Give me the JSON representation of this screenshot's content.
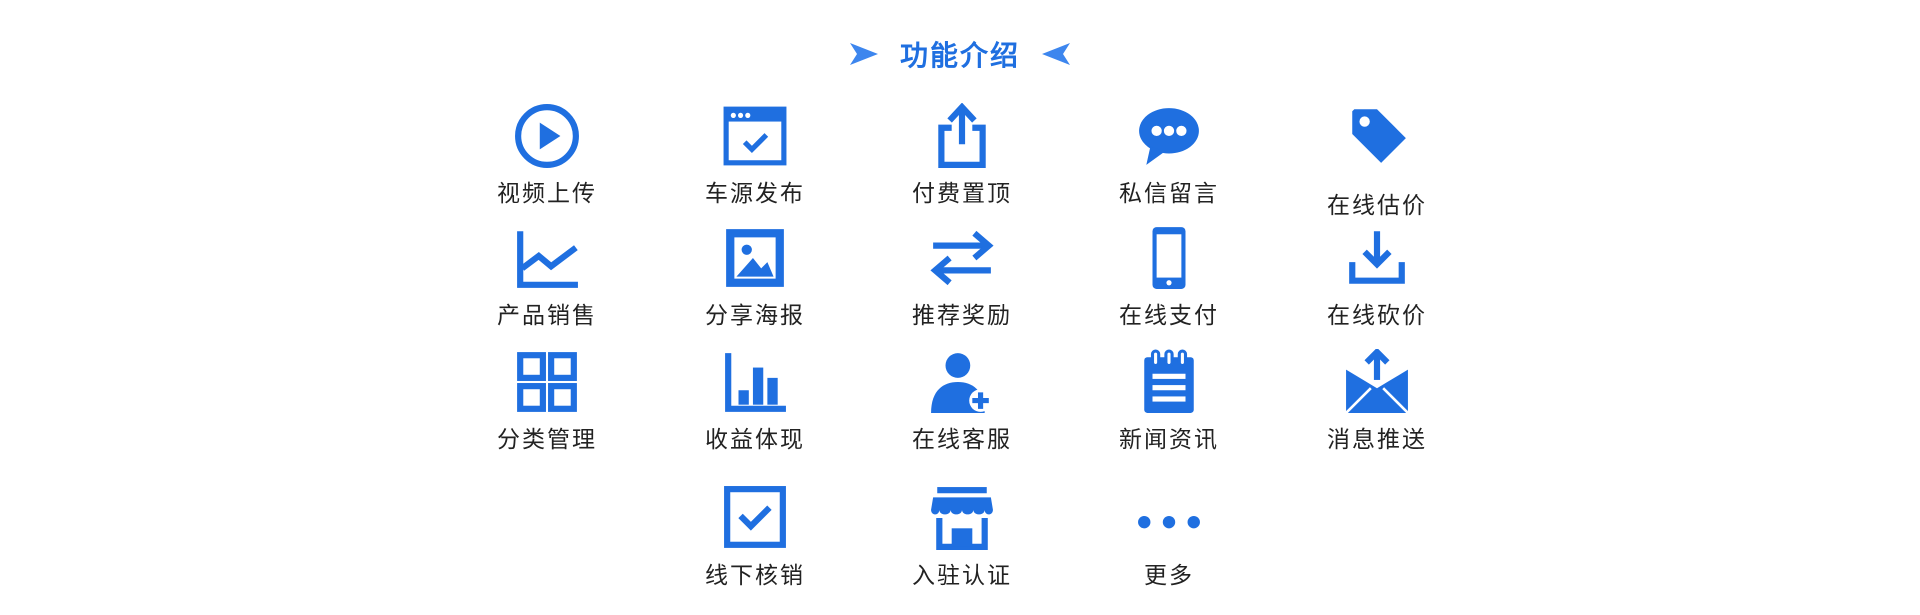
{
  "header": {
    "title": "功能介绍",
    "left_icon": "arrow-right-icon",
    "right_icon": "arrow-left-icon"
  },
  "accent_color": "#1f6fe0",
  "features": [
    {
      "label": "视频上传",
      "icon": "play-circle-icon"
    },
    {
      "label": "车源发布",
      "icon": "browser-window-icon"
    },
    {
      "label": "付费置顶",
      "icon": "share-upload-icon"
    },
    {
      "label": "私信留言",
      "icon": "chat-bubble-icon"
    },
    {
      "label": "在线估价",
      "icon": "price-tag-icon"
    },
    {
      "label": "产品销售",
      "icon": "line-chart-icon"
    },
    {
      "label": "分享海报",
      "icon": "image-poster-icon"
    },
    {
      "label": "推荐奖励",
      "icon": "exchange-arrows-icon"
    },
    {
      "label": "在线支付",
      "icon": "mobile-phone-icon"
    },
    {
      "label": "在线砍价",
      "icon": "download-tray-icon"
    },
    {
      "label": "分类管理",
      "icon": "grid-icon"
    },
    {
      "label": "收益体现",
      "icon": "bar-chart-icon"
    },
    {
      "label": "在线客服",
      "icon": "add-user-icon"
    },
    {
      "label": "新闻资讯",
      "icon": "notepad-icon"
    },
    {
      "label": "消息推送",
      "icon": "mail-upload-icon"
    },
    {
      "label": "线下核销",
      "icon": "checkbox-icon"
    },
    {
      "label": "入驻认证",
      "icon": "storefront-icon"
    },
    {
      "label": "更多",
      "icon": "more-dots-icon"
    }
  ]
}
